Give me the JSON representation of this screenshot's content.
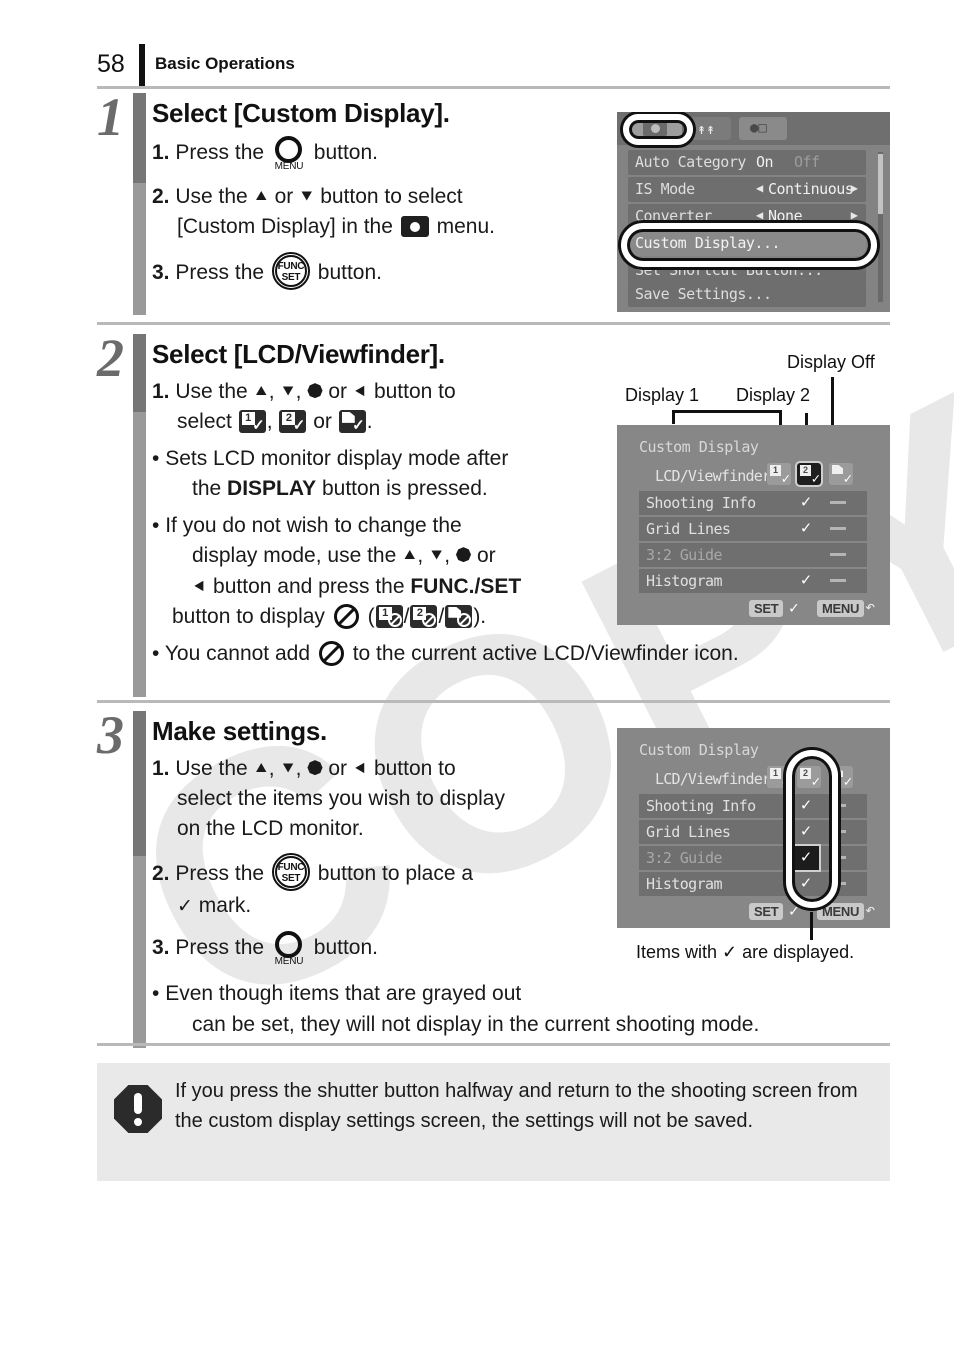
{
  "header": {
    "page_number": "58",
    "title": "Basic Operations"
  },
  "steps": [
    {
      "number": "1",
      "title": "Select [Custom Display].",
      "items": [
        {
          "label": "1.",
          "before": "Press the",
          "icon": "menu-button",
          "after": "button."
        },
        {
          "label": "2.",
          "line1_a": "Use the",
          "arrow_up": "↑",
          "or": "or",
          "arrow_down": "↓",
          "line1_b": "button to select",
          "line2_a": "[Custom Display] in the",
          "icon": "rec-menu-icon",
          "line2_b": "menu."
        },
        {
          "label": "3.",
          "before": "Press the",
          "icon": "func-set-button",
          "after": "button."
        }
      ]
    },
    {
      "number": "2",
      "title": "Select [LCD/Viewfinder].",
      "items": [
        {
          "label": "1.",
          "line1_a": "Use the",
          "line1_b": "button to",
          "line2_a": "select",
          "line2_b": "or",
          "line2_c": "."
        }
      ],
      "bullets": [
        {
          "a": "Sets LCD monitor display mode after",
          "b": "the ",
          "bold": "DISPLAY",
          "c": " button is pressed."
        },
        {
          "a": "If you do not wish to change the",
          "b": "display mode, use the",
          "c": "or",
          "d": "button and press the ",
          "bold": "FUNC./SET",
          "e": "button to display",
          "f": "(",
          "g": "/",
          "h": ")."
        },
        {
          "a": "You cannot add",
          "b": "to the current active LCD/Viewfinder icon."
        }
      ]
    },
    {
      "number": "3",
      "title": "Make settings.",
      "items": [
        {
          "label": "1.",
          "line1_a": "Use the",
          "line1_b": "button to",
          "line2": "select the items you wish to display",
          "line3": "on the LCD monitor."
        },
        {
          "label": "2.",
          "before": "Press the",
          "icon": "func-set-button",
          "after": "button to place a",
          "line2": "mark."
        },
        {
          "label": "3.",
          "before": "Press the",
          "icon": "menu-button",
          "after": "button."
        }
      ],
      "bullets": [
        {
          "a": "Even though items that are grayed out",
          "b": "can be set, they will not display in the current shooting mode."
        }
      ]
    }
  ],
  "screen1": {
    "tabs": [
      {
        "name": "rec-tab",
        "glyph": "camera"
      },
      {
        "name": "setup-tab",
        "glyph": "wrench"
      },
      {
        "name": "my-camera-tab",
        "glyph": "my-camera"
      }
    ],
    "rows": [
      {
        "label": "Auto Category",
        "value_on": "On",
        "value_off": "Off",
        "type": "onoff"
      },
      {
        "label": "IS Mode",
        "value": "Continuous",
        "type": "arrows"
      },
      {
        "label": "Converter",
        "value": "None",
        "type": "arrows"
      },
      {
        "label": "Custom Display...",
        "type": "plain",
        "highlighted": true
      },
      {
        "label": "Set Shortcut Button...",
        "type": "plain"
      },
      {
        "label": "Save Settings...",
        "type": "plain"
      }
    ]
  },
  "screen2": {
    "title": "Custom Display",
    "lcd_viewfinder_label": "LCD/Viewfinder",
    "icons": [
      {
        "name": "display-1-icon",
        "digit": "1",
        "selected": false
      },
      {
        "name": "display-2-icon",
        "digit": "2",
        "selected": true
      },
      {
        "name": "display-off-icon",
        "digit": "",
        "selected": false
      }
    ],
    "rows": [
      {
        "name": "Shooting Info",
        "grayed": false,
        "col1": "",
        "col2": "check",
        "col3": "dash"
      },
      {
        "name": "Grid Lines",
        "grayed": false,
        "col1": "",
        "col2": "check",
        "col3": "dash"
      },
      {
        "name": "3:2 Guide",
        "grayed": true,
        "col1": "",
        "col2": "",
        "col3": "dash"
      },
      {
        "name": "Histogram",
        "grayed": false,
        "col1": "",
        "col2": "check",
        "col3": "dash"
      }
    ],
    "footer": {
      "set_label": "SET",
      "set_mark": "✓",
      "menu_label": "MENU",
      "back_mark": "↶"
    },
    "callouts": [
      {
        "name": "display-1-callout",
        "text": "Display 1"
      },
      {
        "name": "display-2-callout",
        "text": "Display 2"
      },
      {
        "name": "display-off-callout",
        "text": "Display Off"
      }
    ]
  },
  "screen3": {
    "title": "Custom Display",
    "lcd_viewfinder_label": "LCD/Viewfinder",
    "icons": [
      {
        "name": "display-1-icon",
        "digit": "1",
        "selected": false
      },
      {
        "name": "display-2-icon",
        "digit": "2",
        "selected": false
      },
      {
        "name": "display-off-icon",
        "digit": "",
        "selected": false
      }
    ],
    "rows": [
      {
        "name": "Shooting Info",
        "grayed": false,
        "col2": "check",
        "col3": "dash"
      },
      {
        "name": "Grid Lines",
        "grayed": false,
        "col2": "check",
        "col3": "dash"
      },
      {
        "name": "3:2 Guide",
        "grayed": true,
        "col2": "check",
        "col3": "dash",
        "highlighted": true
      },
      {
        "name": "Histogram",
        "grayed": false,
        "col2": "check",
        "col3": "dash"
      }
    ],
    "footer": {
      "set_label": "SET",
      "set_mark": "✓",
      "menu_label": "MENU",
      "back_mark": "↶"
    },
    "caption": "Items with ✓ are displayed."
  },
  "warning": {
    "text": "If you press the shutter button halfway and return to the shooting screen from the custom display settings screen, the settings will not be saved."
  },
  "watermark": {
    "text": "COPY"
  }
}
